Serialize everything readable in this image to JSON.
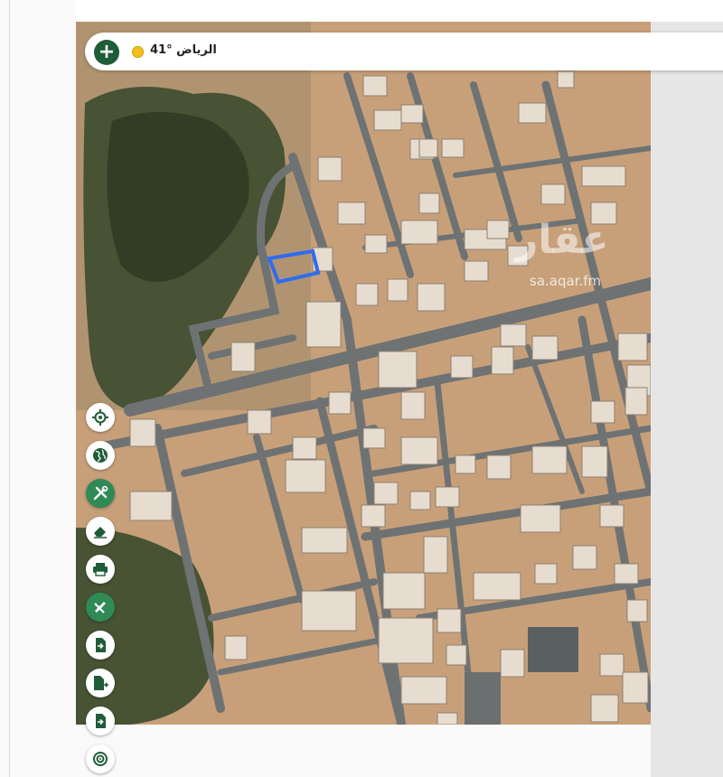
{
  "header": {
    "location_label": "الرياض °41",
    "add_button_label": "+"
  },
  "watermark": {
    "brand": "عقار",
    "url": "sa.aqar.fm"
  },
  "toolbar": [
    {
      "name": "locate-me-button",
      "icon": "crosshair-icon"
    },
    {
      "name": "map-layer-button",
      "icon": "globe-icon"
    },
    {
      "name": "tools-button",
      "icon": "tools-icon"
    },
    {
      "name": "eraser-button",
      "icon": "eraser-icon"
    },
    {
      "name": "print-button",
      "icon": "printer-icon"
    },
    {
      "name": "measure-button",
      "icon": "ruler-pencil-icon"
    },
    {
      "name": "import-file-button",
      "icon": "file-import-icon"
    },
    {
      "name": "export-file-button",
      "icon": "file-export-icon"
    },
    {
      "name": "download-file-button",
      "icon": "file-download-icon"
    },
    {
      "name": "target-button",
      "icon": "target-icon"
    }
  ],
  "colors": {
    "brand_green": "#1f5c38",
    "parcel_outline": "#2f6cf0",
    "coin": "#f2c21a"
  }
}
